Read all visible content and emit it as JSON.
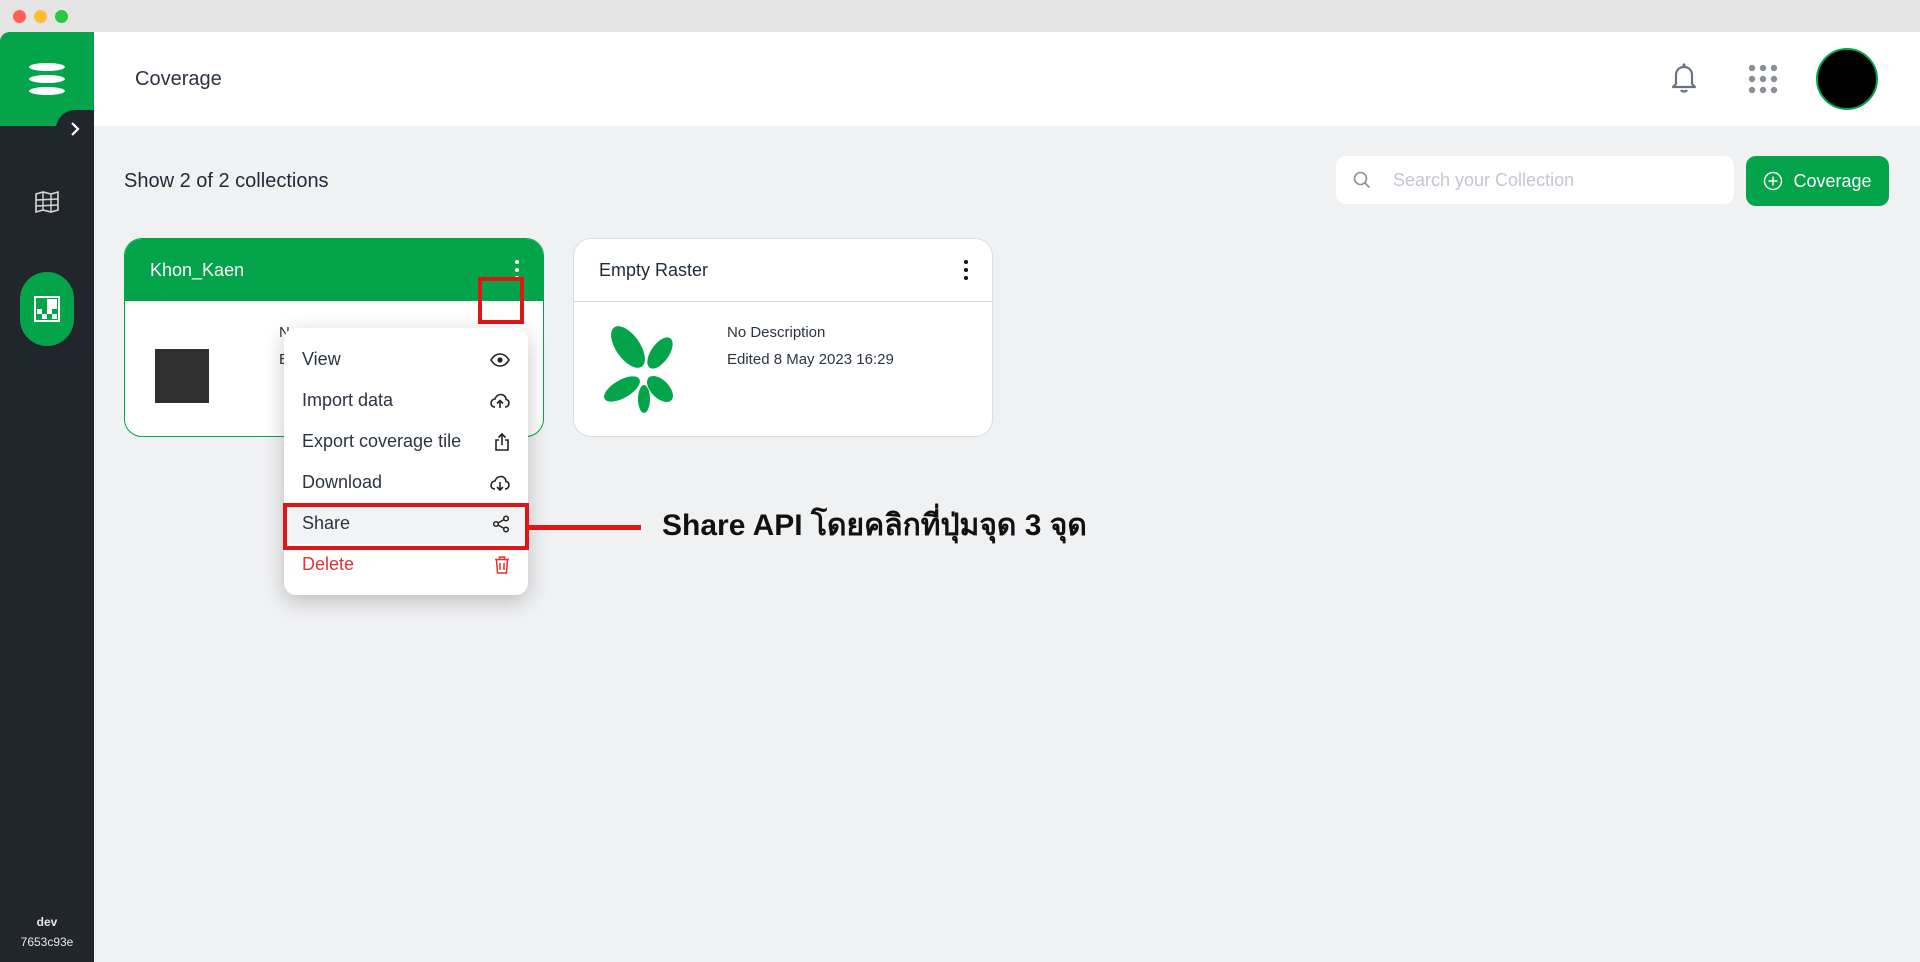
{
  "header": {
    "title": "Coverage"
  },
  "toolbar": {
    "count_text": "Show 2 of 2 collections",
    "search_placeholder": "Search your Collection",
    "add_button_label": "Coverage"
  },
  "sidebar": {
    "env_name": "dev",
    "env_hash": "7653c93e"
  },
  "cards": [
    {
      "title": "Khon_Kaen",
      "description": "N",
      "edited": "E"
    },
    {
      "title": "Empty Raster",
      "description": "No Description",
      "edited": "Edited 8 May 2023 16:29"
    }
  ],
  "menu": {
    "items": [
      {
        "label": "View",
        "icon": "eye-icon"
      },
      {
        "label": "Import data",
        "icon": "cloud-upload-icon"
      },
      {
        "label": "Export coverage tile",
        "icon": "export-icon"
      },
      {
        "label": "Download",
        "icon": "cloud-download-icon"
      },
      {
        "label": "Share",
        "icon": "share-icon"
      },
      {
        "label": "Delete",
        "icon": "trash-icon"
      }
    ]
  },
  "annotation": {
    "text": "Share API โดยคลิกที่ปุ่มจุด 3 จุด"
  },
  "colors": {
    "brand": "#04a44a",
    "sidebar": "#21262d",
    "danger": "#e5322d",
    "highlight": "#e01616"
  }
}
